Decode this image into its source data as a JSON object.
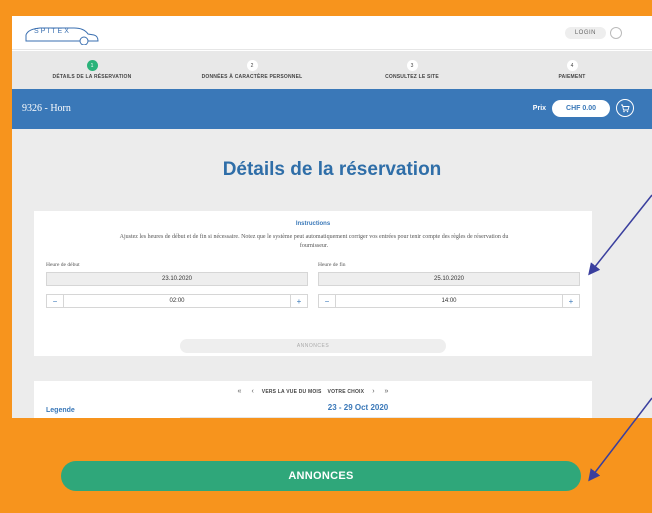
{
  "topbar": {
    "logo_text": "SPITEX",
    "login_label": "LOGIN"
  },
  "steps": [
    {
      "num": "1",
      "label": "DÉTAILS DE LA RÉSERVATION",
      "active": true
    },
    {
      "num": "2",
      "label": "DONNÉES À CARACTÈRE PERSONNEL",
      "active": false
    },
    {
      "num": "3",
      "label": "CONSULTEZ LE SITE",
      "active": false
    },
    {
      "num": "4",
      "label": "PAIEMENT",
      "active": false
    }
  ],
  "header": {
    "booking_id": "9326 - Horn",
    "price_label": "Prix",
    "price_value": "CHF 0.00"
  },
  "main": {
    "title": "Détails de la réservation",
    "instructions_title": "Instructions",
    "instructions_text": "Ajustez les heures de début et de fin si nécessaire. Notez que le système peut automatiquement corriger vos entrées pour tenir compte des règles de réservation du fournisseur.",
    "start_label": "Heure de début",
    "end_label": "Heure de fin",
    "start_date": "23.10.2020",
    "end_date": "25.10.2020",
    "start_time": "02:00",
    "end_time": "14:00",
    "minus": "−",
    "plus": "+",
    "annonces_small": "ANNONCES"
  },
  "calendar": {
    "first_label": "«",
    "prev_label": "‹",
    "month_view_label": "VERS LA VUE DU MOIS",
    "choice_label": "VOTRE CHOIX",
    "next_label": "›",
    "last_label": "»",
    "legend_label": "Legende",
    "week_label": "23 - 29 Oct 2020"
  },
  "big_button": {
    "label": "ANNONCES"
  },
  "colors": {
    "orange": "#f7941d",
    "blue": "#3a78b8",
    "green": "#2fa77a",
    "arrow": "#3a3f9e"
  }
}
